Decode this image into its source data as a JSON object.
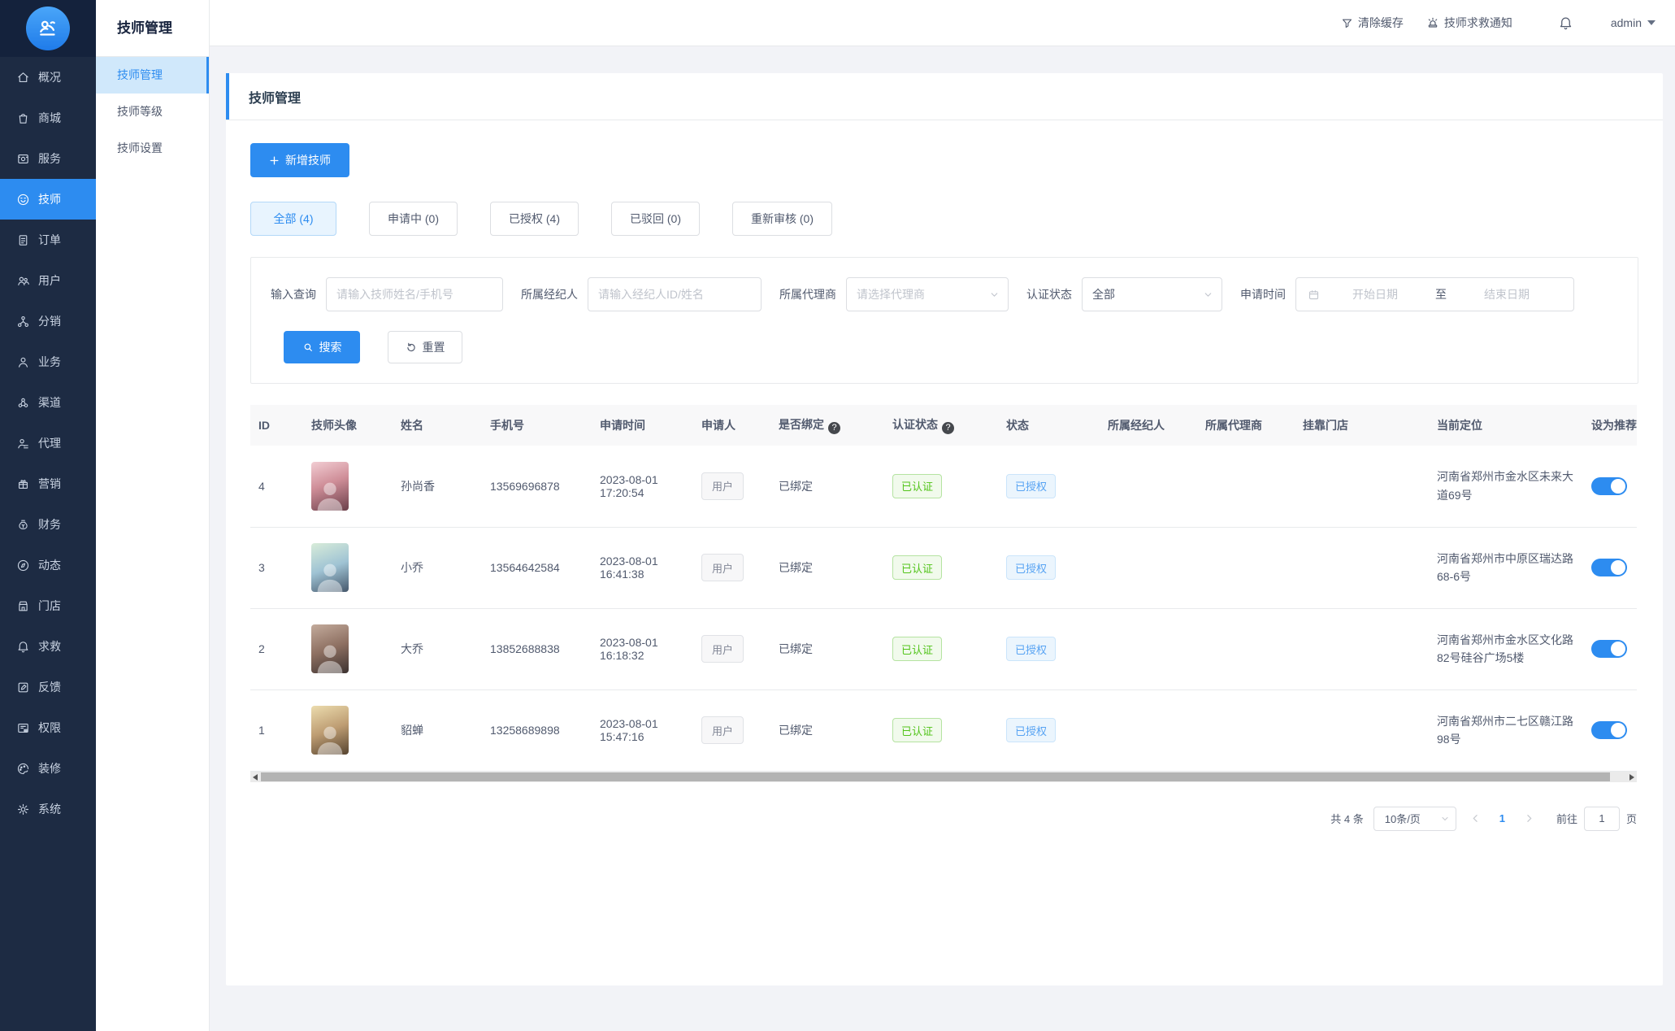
{
  "colors": {
    "primary": "#2d8cf0",
    "sidebar_bg": "#1d2b43",
    "success_text": "#52c41a",
    "info_tag_text": "#57a3f3",
    "page_bg": "#f2f3f7"
  },
  "sidebar": {
    "items": [
      {
        "label": "概况",
        "icon": "home-icon"
      },
      {
        "label": "商城",
        "icon": "mall-icon"
      },
      {
        "label": "服务",
        "icon": "service-icon"
      },
      {
        "label": "技师",
        "icon": "technician-icon",
        "active": true
      },
      {
        "label": "订单",
        "icon": "order-icon"
      },
      {
        "label": "用户",
        "icon": "users-icon"
      },
      {
        "label": "分销",
        "icon": "distribution-icon"
      },
      {
        "label": "业务",
        "icon": "business-icon"
      },
      {
        "label": "渠道",
        "icon": "channel-icon"
      },
      {
        "label": "代理",
        "icon": "agent-icon"
      },
      {
        "label": "营销",
        "icon": "marketing-icon"
      },
      {
        "label": "财务",
        "icon": "finance-icon"
      },
      {
        "label": "动态",
        "icon": "news-icon"
      },
      {
        "label": "门店",
        "icon": "store-icon"
      },
      {
        "label": "求救",
        "icon": "sos-icon"
      },
      {
        "label": "反馈",
        "icon": "feedback-icon"
      },
      {
        "label": "权限",
        "icon": "permission-icon"
      },
      {
        "label": "装修",
        "icon": "decorate-icon"
      },
      {
        "label": "系统",
        "icon": "system-icon"
      }
    ]
  },
  "submenu": {
    "title": "技师管理",
    "items": [
      {
        "label": "技师管理",
        "active": true
      },
      {
        "label": "技师等级"
      },
      {
        "label": "技师设置"
      }
    ]
  },
  "topbar": {
    "clear_cache": "清除缓存",
    "sos_notice": "技师求救通知",
    "username": "admin"
  },
  "page": {
    "card_title": "技师管理",
    "add_button": "新增技师"
  },
  "tabs": [
    {
      "label": "全部 (4)",
      "active": true
    },
    {
      "label": "申请中 (0)"
    },
    {
      "label": "已授权 (4)"
    },
    {
      "label": "已驳回 (0)"
    },
    {
      "label": "重新审核 (0)"
    }
  ],
  "filters": {
    "query_label": "输入查询",
    "query_placeholder": "请输入技师姓名/手机号",
    "agent_label": "所属经纪人",
    "agent_placeholder": "请输入经纪人ID/姓名",
    "agency_label": "所属代理商",
    "agency_placeholder": "请选择代理商",
    "cert_label": "认证状态",
    "cert_value": "全部",
    "time_label": "申请时间",
    "date_start_placeholder": "开始日期",
    "date_separator": "至",
    "date_end_placeholder": "结束日期",
    "search_button": "搜索",
    "reset_button": "重置"
  },
  "table": {
    "columns": {
      "id": "ID",
      "avatar": "技师头像",
      "name": "姓名",
      "phone": "手机号",
      "apply_time": "申请时间",
      "applicant": "申请人",
      "bound": "是否绑定",
      "cert": "认证状态",
      "status": "状态",
      "agent": "所属经纪人",
      "agency": "所属代理商",
      "store": "挂靠门店",
      "location": "当前定位",
      "recommend": "设为推荐"
    },
    "rows": [
      {
        "id": "4",
        "name": "孙尚香",
        "phone": "13569696878",
        "date": "2023-08-01",
        "time": "17:20:54",
        "applicant": "用户",
        "bound": "已绑定",
        "cert": "已认证",
        "status": "已授权",
        "location": "河南省郑州市金水区未来大道69号",
        "recommend_on": true,
        "avatar_gradient": "linear-gradient(160deg,#f2cdd3 0%,#cf8e98 45%,#6b3f4a 100%)"
      },
      {
        "id": "3",
        "name": "小乔",
        "phone": "13564642584",
        "date": "2023-08-01",
        "time": "16:41:38",
        "applicant": "用户",
        "bound": "已绑定",
        "cert": "已认证",
        "status": "已授权",
        "location": "河南省郑州市中原区瑞达路68-6号",
        "recommend_on": true,
        "avatar_gradient": "linear-gradient(160deg,#d8ecd9 0%,#9fc3d4 50%,#46586c 100%)"
      },
      {
        "id": "2",
        "name": "大乔",
        "phone": "13852688838",
        "date": "2023-08-01",
        "time": "16:18:32",
        "applicant": "用户",
        "bound": "已绑定",
        "cert": "已认证",
        "status": "已授权",
        "location": "河南省郑州市金水区文化路82号硅谷广场5楼",
        "recommend_on": true,
        "avatar_gradient": "linear-gradient(160deg,#c3ab9c 0%,#8d6f61 50%,#3c3230 100%)"
      },
      {
        "id": "1",
        "name": "貂蝉",
        "phone": "13258689898",
        "date": "2023-08-01",
        "time": "15:47:16",
        "applicant": "用户",
        "bound": "已绑定",
        "cert": "已认证",
        "status": "已授权",
        "location": "河南省郑州市二七区赣江路98号",
        "recommend_on": true,
        "avatar_gradient": "linear-gradient(160deg,#ecdcae 0%,#bd9c72 50%,#574430 100%)"
      }
    ]
  },
  "pagination": {
    "total": "共 4 条",
    "page_size": "10条/页",
    "current_page": "1",
    "goto_label": "前往",
    "goto_value": "1",
    "page_unit": "页"
  }
}
